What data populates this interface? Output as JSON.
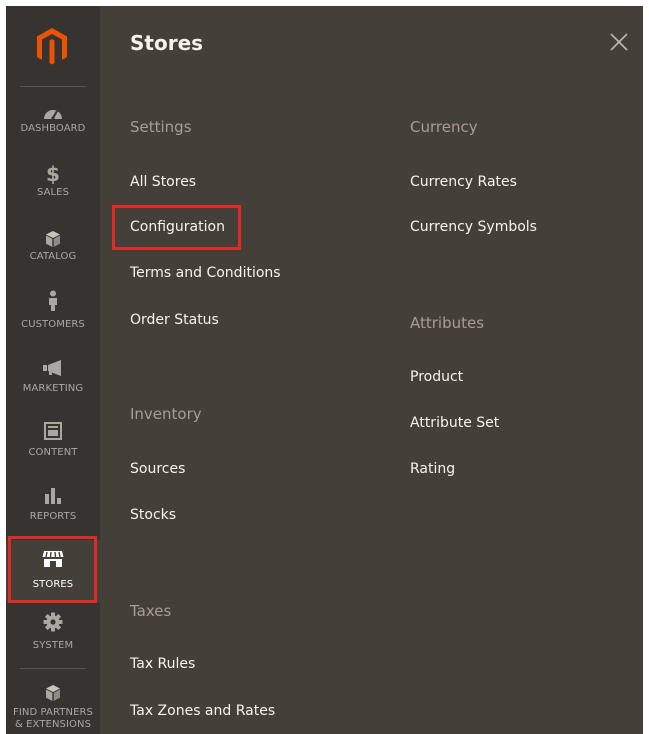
{
  "sidebar": {
    "items": [
      {
        "label": "DASHBOARD",
        "icon": "dashboard-icon"
      },
      {
        "label": "SALES",
        "icon": "dollar-icon"
      },
      {
        "label": "CATALOG",
        "icon": "box-icon"
      },
      {
        "label": "CUSTOMERS",
        "icon": "person-icon"
      },
      {
        "label": "MARKETING",
        "icon": "megaphone-icon"
      },
      {
        "label": "CONTENT",
        "icon": "content-layout-icon"
      },
      {
        "label": "REPORTS",
        "icon": "bar-chart-icon"
      },
      {
        "label": "STORES",
        "icon": "storefront-icon",
        "active": true
      },
      {
        "label": "SYSTEM",
        "icon": "gear-icon"
      },
      {
        "label_line1": "FIND PARTNERS",
        "label_line2": "& EXTENSIONS",
        "icon": "extensions-box-icon"
      }
    ]
  },
  "panel": {
    "title": "Stores",
    "close_icon": "close-icon",
    "sections": {
      "settings": {
        "title": "Settings",
        "links": [
          "All Stores",
          "Configuration",
          "Terms and Conditions",
          "Order Status"
        ]
      },
      "inventory": {
        "title": "Inventory",
        "links": [
          "Sources",
          "Stocks"
        ]
      },
      "taxes": {
        "title": "Taxes",
        "links": [
          "Tax Rules",
          "Tax Zones and Rates"
        ]
      },
      "currency": {
        "title": "Currency",
        "links": [
          "Currency Rates",
          "Currency Symbols"
        ]
      },
      "attributes": {
        "title": "Attributes",
        "links": [
          "Product",
          "Attribute Set",
          "Rating"
        ]
      }
    }
  },
  "colors": {
    "sidebar_bg": "#373330",
    "panel_bg": "#453f3a",
    "brand_orange": "#eb5202",
    "highlight_red": "#e02b27",
    "link_text": "#f7f3eb",
    "section_title": "#a79d95"
  }
}
